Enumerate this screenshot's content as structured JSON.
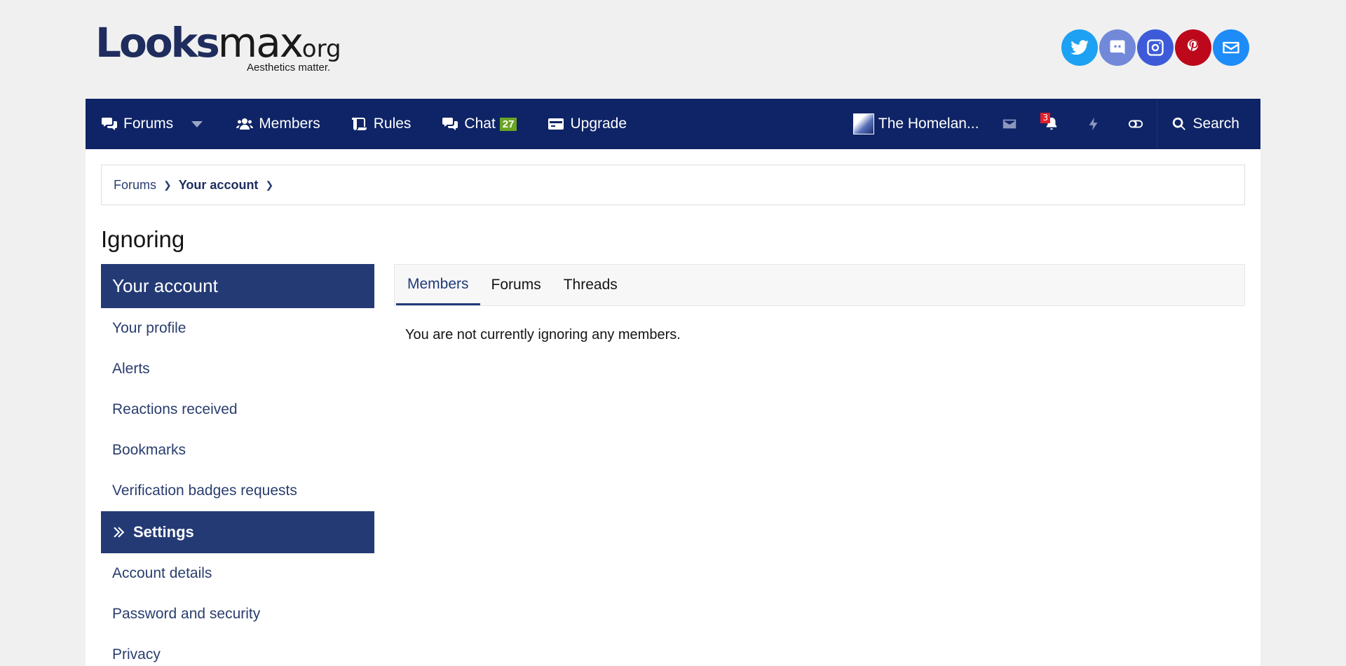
{
  "logo": {
    "main_blue": "Lo",
    "main_o": "oks",
    "main_dark": "max",
    "org": ".org",
    "tagline": "Aesthetics matter."
  },
  "social": [
    {
      "name": "twitter-icon",
      "color": "#1da1f2"
    },
    {
      "name": "discord-icon",
      "color": "#7289da"
    },
    {
      "name": "instagram-icon",
      "color": "#3d5bd9"
    },
    {
      "name": "pinterest-icon",
      "color": "#bd081c"
    },
    {
      "name": "email-icon",
      "color": "#1d8cf8"
    }
  ],
  "nav": {
    "forums": "Forums",
    "members": "Members",
    "rules": "Rules",
    "chat": "Chat",
    "chat_count": "27",
    "upgrade": "Upgrade",
    "user": "The Homelan...",
    "alerts_count": "3",
    "search": "Search"
  },
  "breadcrumb": {
    "first": "Forums",
    "second": "Your account"
  },
  "page_title": "Ignoring",
  "sidebar": {
    "header": "Your account",
    "items": [
      "Your profile",
      "Alerts",
      "Reactions received",
      "Bookmarks",
      "Verification badges requests"
    ],
    "settings_header": "Settings",
    "settings_items": [
      "Account details",
      "Password and security",
      "Privacy"
    ]
  },
  "tabs": [
    "Members",
    "Forums",
    "Threads"
  ],
  "message": "You are not currently ignoring any members.",
  "colors": {
    "nav": "#0f2466",
    "accent": "#243a75",
    "chat_badge": "#6ba524",
    "alert_badge": "#e0202a"
  }
}
